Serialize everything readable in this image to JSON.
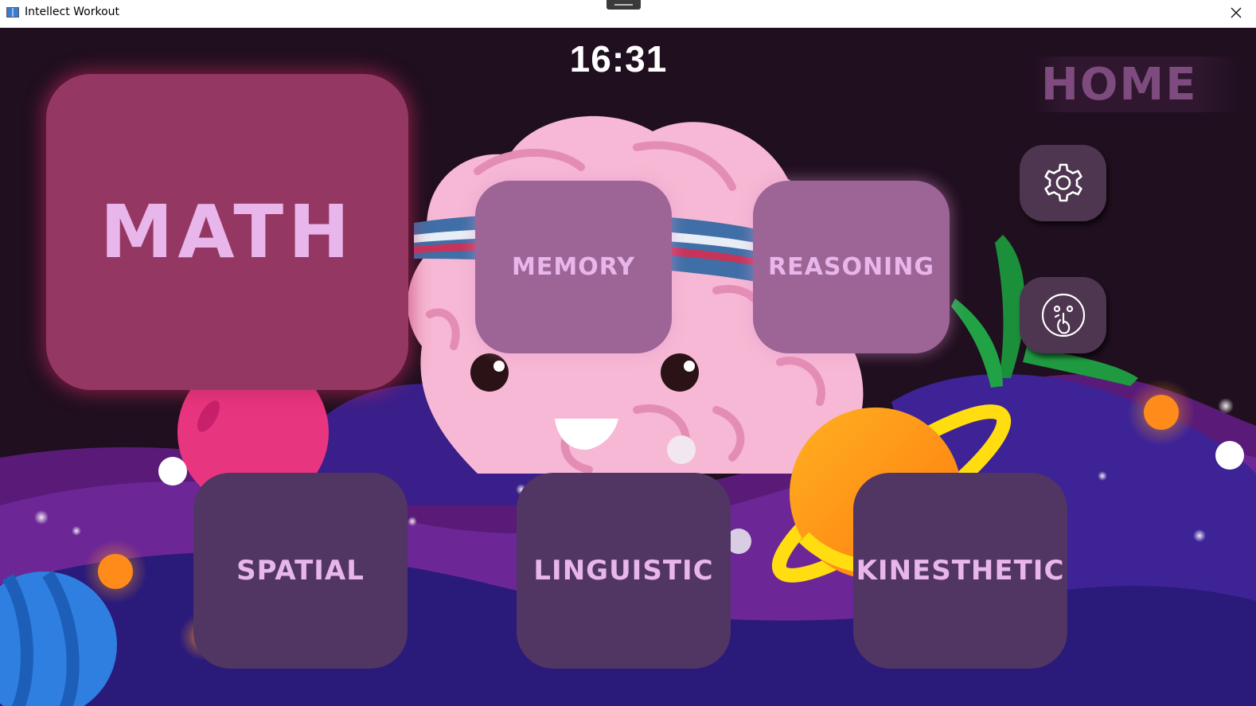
{
  "window": {
    "title": "Intellect Workout"
  },
  "header": {
    "time": "16:31",
    "page_label": "HOME"
  },
  "categories": {
    "math": "MATH",
    "memory": "MEMORY",
    "reasoning": "REASONING",
    "spatial": "SPATIAL",
    "linguistic": "LINGUISTIC",
    "kinesthetic": "KINESTHETIC"
  },
  "controls": {
    "settings_icon": "gear-icon",
    "mute_icon": "shush-face-icon"
  },
  "colors": {
    "background": "#200f1f",
    "math_tile": "#953763",
    "upper_tiles": "#9c6596",
    "lower_tiles": "#513562",
    "tile_text": "#e8b6ea"
  }
}
